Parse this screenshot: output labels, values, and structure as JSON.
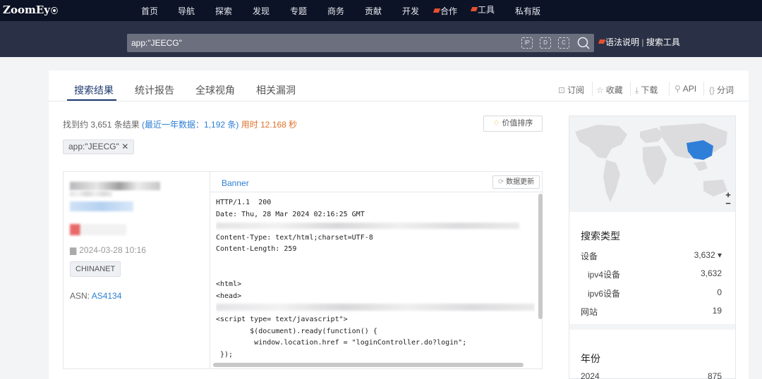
{
  "topnav": {
    "logo": "ZoomEy",
    "items": [
      "首页",
      "导航",
      "探索",
      "发现",
      "专题",
      "商务",
      "贡献",
      "开发",
      "合作",
      "工具",
      "私有版"
    ]
  },
  "search": {
    "query": "app:\"JEECG\"",
    "icon_labels": [
      "IP",
      "D",
      "C"
    ],
    "links": [
      "语法说明",
      "搜索工具"
    ]
  },
  "tabs": [
    "搜索结果",
    "统计报告",
    "全球视角",
    "相关漏洞"
  ],
  "tools": [
    "订阅",
    "收藏",
    "下载",
    "API",
    "分词"
  ],
  "summary": {
    "prefix": "找到约 3,651 条结果",
    "recent": "(最近一年数据：1,192 条)",
    "time": "用时 12.168 秒"
  },
  "sort_button": "价值排序",
  "filter_chip": "app:\"JEECG\" ✕",
  "result": {
    "datetime": "2024-03-28 10:16",
    "isp": "CHINANET",
    "asn_label": "ASN:",
    "asn_value": "AS4134",
    "banner_tab": "Banner",
    "refresh_button": "数据更新",
    "banner_lines": [
      "HTTP/1.1  200",
      "Date: Thu, 28 Mar 2024 02:16:25 GMT",
      "",
      "Content-Type: text/html;charset=UTF-8",
      "Content-Length: 259",
      "",
      "",
      "<html>",
      "<head>",
      "",
      "<script type= text/javascript\">",
      "        $(document).ready(function() {",
      "         window.location.href = \"loginController.do?login\";",
      " });"
    ]
  },
  "sidebar": {
    "stats_title": "搜索类型",
    "rows": [
      {
        "label": "设备",
        "value": "3,632 ▾"
      },
      {
        "label": "ipv4设备",
        "value": "3,632"
      },
      {
        "label": "ipv6设备",
        "value": "0"
      },
      {
        "label": "网站",
        "value": "19"
      }
    ],
    "year_title": "年份",
    "year_rows": [
      {
        "label": "2024",
        "value": "875"
      }
    ],
    "zoom_in": "+",
    "zoom_out": "−"
  }
}
